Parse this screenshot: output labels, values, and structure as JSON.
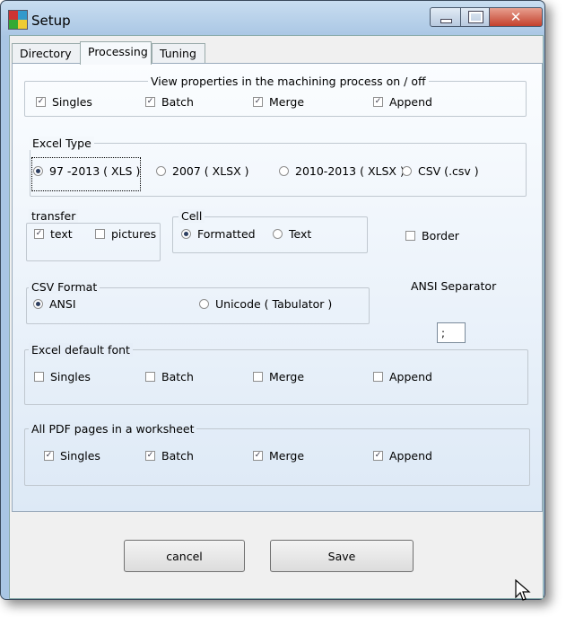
{
  "window": {
    "title": "Setup",
    "close_glyph": "✕"
  },
  "tabs": [
    "Directory",
    "Processing",
    "Tuning"
  ],
  "view_props": {
    "legend": "View properties in the machining process on / off",
    "items": [
      {
        "label": "Singles",
        "checked": true
      },
      {
        "label": "Batch",
        "checked": true
      },
      {
        "label": "Merge",
        "checked": true
      },
      {
        "label": "Append",
        "checked": true
      }
    ]
  },
  "excel_type": {
    "legend": "Excel Type",
    "options": [
      "97 -2013 (  XLS )",
      "2007 ( XLSX  )",
      "2010-2013 ( XLSX )",
      "CSV  (.csv )"
    ],
    "selected": 0
  },
  "transfer": {
    "legend": "transfer",
    "items": [
      {
        "label": "text",
        "checked": true
      },
      {
        "label": "pictures",
        "checked": false
      }
    ]
  },
  "cell": {
    "legend": "Cell",
    "options": [
      "Formatted",
      "Text"
    ],
    "selected": 0
  },
  "border": {
    "label": "Border",
    "checked": false
  },
  "csv_format": {
    "legend": "CSV Format",
    "options": [
      "ANSI",
      "Unicode ( Tabulator )"
    ],
    "selected": 0
  },
  "ansi_separator": {
    "label": "ANSI Separator",
    "value": ";"
  },
  "default_font": {
    "legend": "Excel default font",
    "items": [
      {
        "label": "Singles",
        "checked": false
      },
      {
        "label": "Batch",
        "checked": false
      },
      {
        "label": "Merge",
        "checked": false
      },
      {
        "label": "Append",
        "checked": false
      }
    ]
  },
  "pdf_pages": {
    "legend": "All PDF pages in a worksheet",
    "items": [
      {
        "label": "Singles",
        "checked": true
      },
      {
        "label": "Batch",
        "checked": true
      },
      {
        "label": "Merge",
        "checked": true
      },
      {
        "label": "Append",
        "checked": true
      }
    ]
  },
  "buttons": {
    "cancel": "cancel",
    "save": "Save"
  },
  "check_glyph": "✓"
}
